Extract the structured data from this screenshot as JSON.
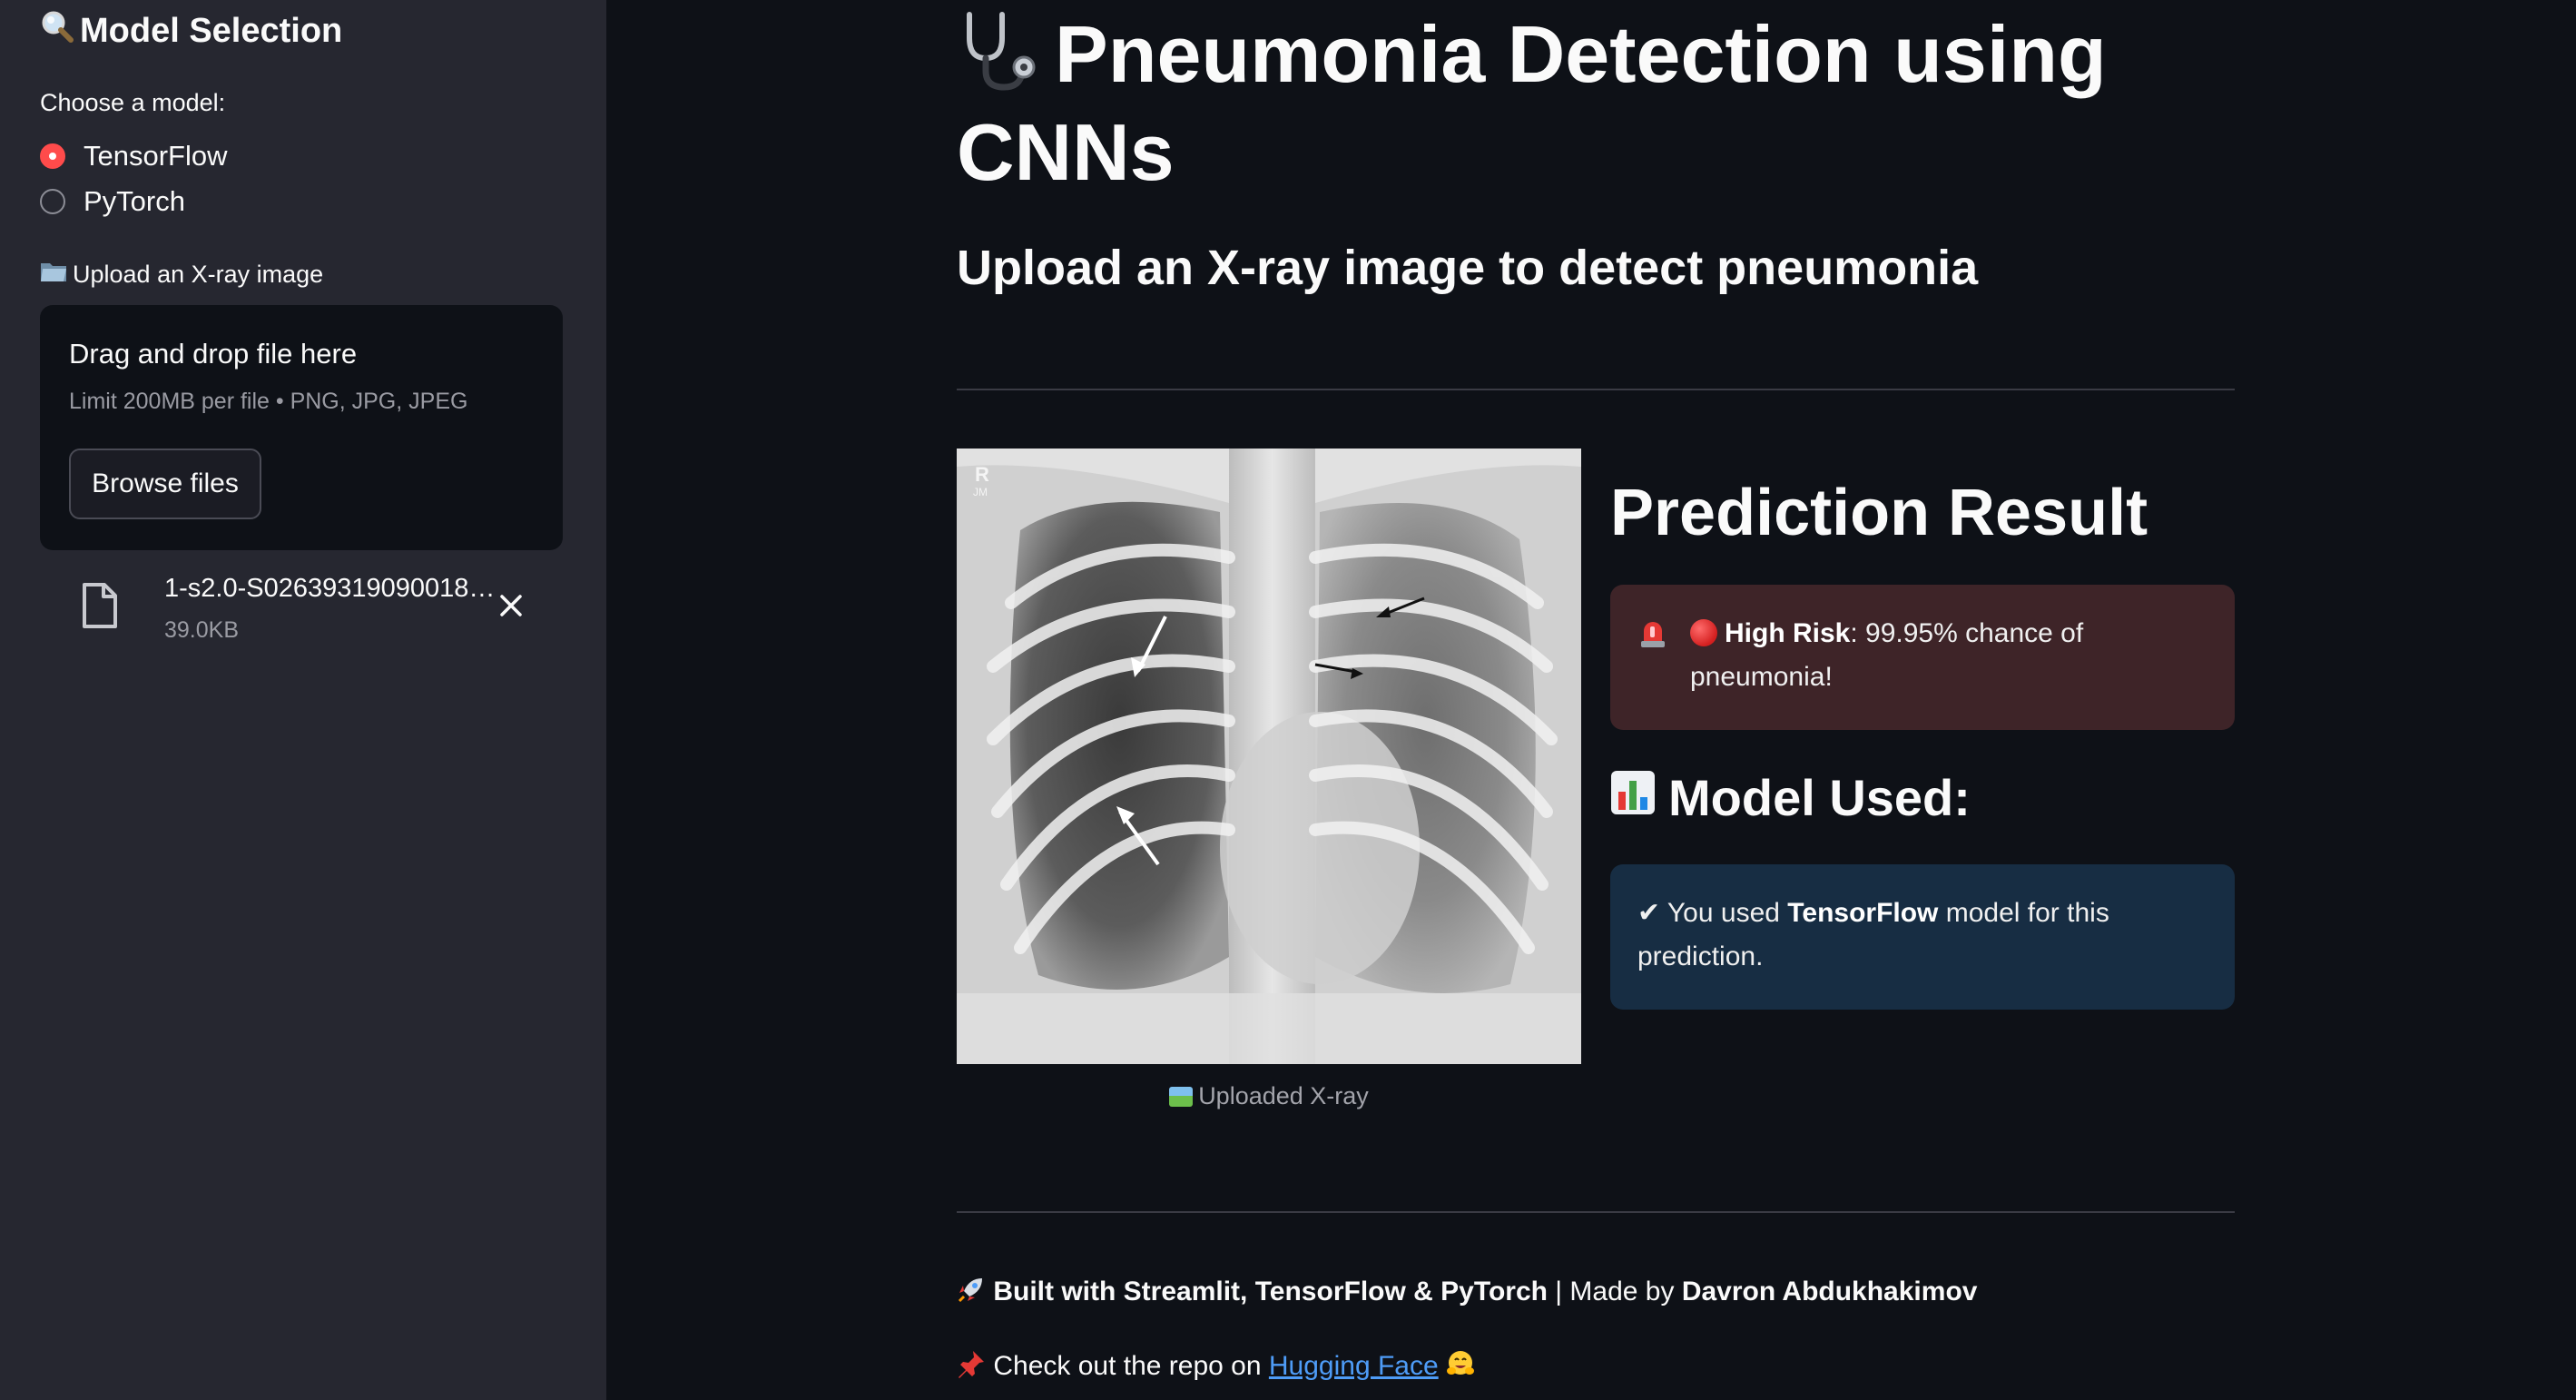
{
  "sidebar": {
    "title": "Model Selection",
    "title_icon": "magnifier-icon",
    "model_label": "Choose a model:",
    "models": [
      {
        "label": "TensorFlow",
        "selected": true
      },
      {
        "label": "PyTorch",
        "selected": false
      }
    ],
    "upload_label": "Upload an X-ray image",
    "upload_icon": "folder-icon",
    "dropzone": {
      "title": "Drag and drop file here",
      "subtitle": "Limit 200MB per file • PNG, JPG, JPEG",
      "button": "Browse files"
    },
    "file": {
      "name": "1-s2.0-S02639319090018…",
      "size": "39.0KB"
    }
  },
  "main": {
    "title": "Pneumonia Detection using CNNs",
    "title_icon": "stethoscope-icon",
    "subtitle": "Upload an X-ray image to detect pneumonia",
    "image_caption": "Uploaded X-ray",
    "prediction": {
      "title": "Prediction Result",
      "risk_label": "High Risk",
      "risk_text": ": 99.95% chance of pneumonia!",
      "risk_percent": 99.95
    },
    "model_used": {
      "title": "Model Used:",
      "text_before": "✔ You used ",
      "model": "TensorFlow",
      "text_after": " model for this prediction."
    },
    "footer": {
      "built_with": "Built with Streamlit, TensorFlow & PyTorch",
      "made_by_prefix": " | Made by ",
      "author": "Davron Abdukhakimov",
      "repo_prefix": "Check out the repo on ",
      "repo_link": "Hugging Face"
    }
  },
  "colors": {
    "background": "#0e1117",
    "sidebar": "#262730",
    "accent": "#ff4b4b",
    "error_bg": "#3e2428",
    "info_bg": "#172d43",
    "link": "#4e9cf7"
  }
}
